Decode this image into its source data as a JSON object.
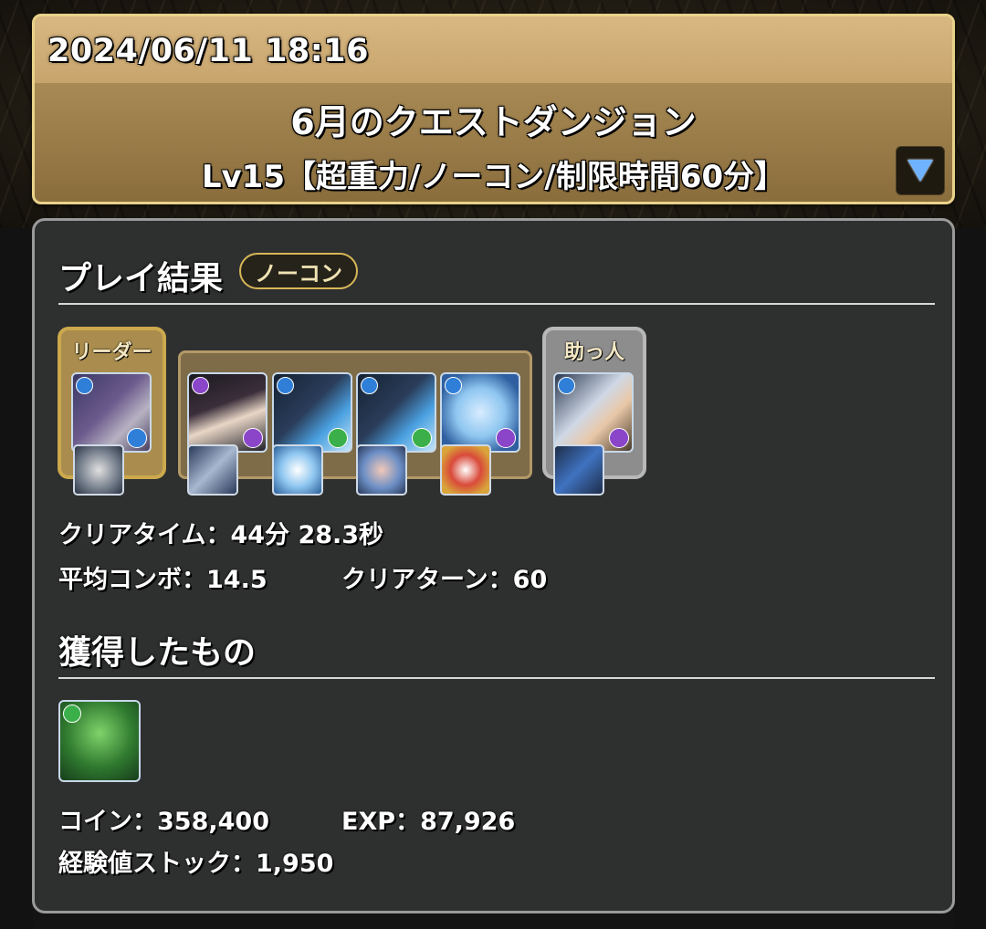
{
  "header": {
    "date": "2024/06/11 18:16",
    "quest_title": "6月のクエストダンジョン",
    "quest_level": "Lv15【超重力/ノーコン/制限時間60分】",
    "expand_icon": "triangle-down-icon"
  },
  "result": {
    "title": "プレイ結果",
    "badge": "ノーコン",
    "leader_label": "リーダー",
    "helper_label": "助っ人",
    "clear_time_label": "クリアタイム：",
    "clear_time_value": "44分 28.3秒",
    "avg_combo_label": "平均コンボ：",
    "avg_combo_value": "14.5",
    "clear_turn_label": "クリアターン：",
    "clear_turn_value": "60"
  },
  "rewards": {
    "title": "獲得したもの",
    "coin_label": "コイン：",
    "coin_value": "358,400",
    "exp_label": "EXP：",
    "exp_value": "87,926",
    "stock_label": "経験値ストック：",
    "stock_value": "1,950"
  },
  "colors": {
    "water": "#2f7fd8",
    "dark": "#8a45c9",
    "wood": "#3bb04a",
    "gold_frame": "#cda94d"
  }
}
